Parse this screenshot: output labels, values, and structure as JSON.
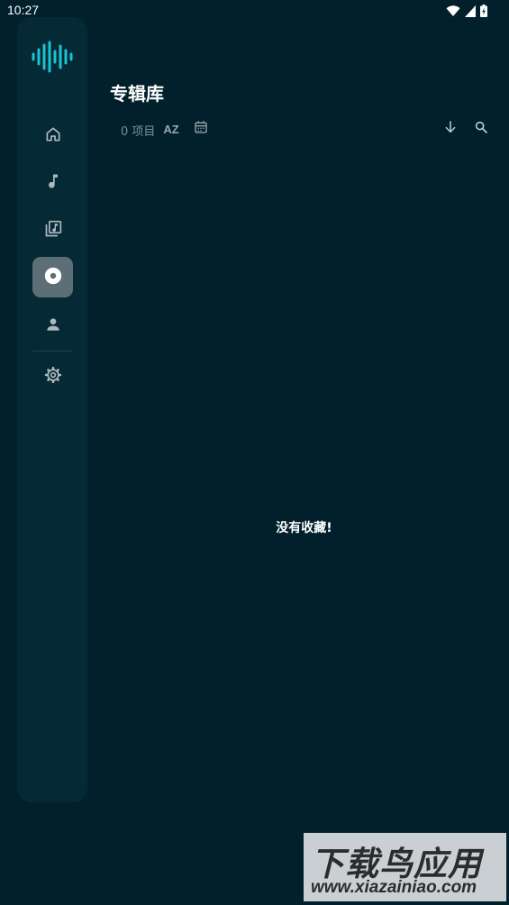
{
  "status_bar": {
    "time": "10:27",
    "icons": [
      "wifi-icon",
      "signal-icon",
      "battery-icon"
    ]
  },
  "sidebar": {
    "logo": "waveform-logo",
    "items": [
      {
        "name": "home",
        "icon": "home-icon",
        "active": false
      },
      {
        "name": "songs",
        "icon": "music-note-icon",
        "active": false
      },
      {
        "name": "playlists",
        "icon": "library-music-icon",
        "active": false
      },
      {
        "name": "albums",
        "icon": "album-icon",
        "active": true
      },
      {
        "name": "artists",
        "icon": "person-icon",
        "active": false
      },
      {
        "name": "settings",
        "icon": "gear-icon",
        "active": false
      }
    ]
  },
  "header": {
    "title": "专辑库"
  },
  "toolbar": {
    "item_count": "0 项目",
    "sort_alpha_label": "AZ",
    "icons": [
      "sort-alpha-icon",
      "calendar-icon",
      "sort-direction-icon",
      "search-icon"
    ]
  },
  "main": {
    "empty_message": "没有收藏!"
  },
  "watermark": {
    "text": "下载鸟应用",
    "url": "www.xiazainiao.com"
  },
  "colors": {
    "background": "#01202b",
    "sidebar": "#052a36",
    "active_item": "#5c6e76",
    "accent": "#1cc3cf",
    "muted_text": "#7e8f96"
  }
}
